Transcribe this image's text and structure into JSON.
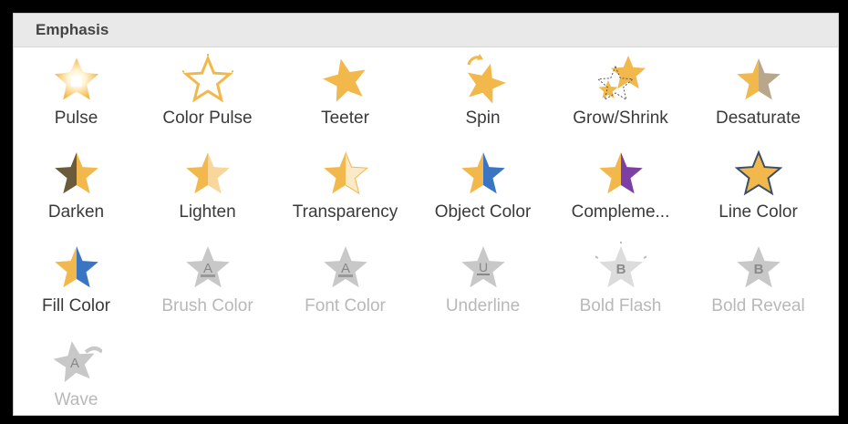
{
  "header": {
    "title": "Emphasis"
  },
  "colors": {
    "gold": "#f2b84b",
    "disabled": "#c8c8c8",
    "purple": "#7b3fa6",
    "blue": "#3a75c4"
  },
  "rows": [
    [
      {
        "label": "Pulse",
        "icon": "pulse-icon",
        "enabled": true
      },
      {
        "label": "Color Pulse",
        "icon": "color-pulse-icon",
        "enabled": true
      },
      {
        "label": "Teeter",
        "icon": "teeter-icon",
        "enabled": true
      },
      {
        "label": "Spin",
        "icon": "spin-icon",
        "enabled": true
      },
      {
        "label": "Grow/Shrink",
        "icon": "grow-shrink-icon",
        "enabled": true
      },
      {
        "label": "Desaturate",
        "icon": "desaturate-icon",
        "enabled": true
      }
    ],
    [
      {
        "label": "Darken",
        "icon": "darken-icon",
        "enabled": true
      },
      {
        "label": "Lighten",
        "icon": "lighten-icon",
        "enabled": true
      },
      {
        "label": "Transparency",
        "icon": "transparency-icon",
        "enabled": true
      },
      {
        "label": "Object Color",
        "icon": "object-color-icon",
        "enabled": true
      },
      {
        "label": "Compleme...",
        "icon": "complementary-color-icon",
        "enabled": true
      },
      {
        "label": "Line Color",
        "icon": "line-color-icon",
        "enabled": true
      }
    ],
    [
      {
        "label": "Fill Color",
        "icon": "fill-color-icon",
        "enabled": true
      },
      {
        "label": "Brush Color",
        "icon": "brush-color-icon",
        "enabled": false
      },
      {
        "label": "Font Color",
        "icon": "font-color-icon",
        "enabled": false
      },
      {
        "label": "Underline",
        "icon": "underline-icon",
        "enabled": false
      },
      {
        "label": "Bold Flash",
        "icon": "bold-flash-icon",
        "enabled": false
      },
      {
        "label": "Bold Reveal",
        "icon": "bold-reveal-icon",
        "enabled": false
      }
    ],
    [
      {
        "label": "Wave",
        "icon": "wave-icon",
        "enabled": false
      }
    ]
  ]
}
